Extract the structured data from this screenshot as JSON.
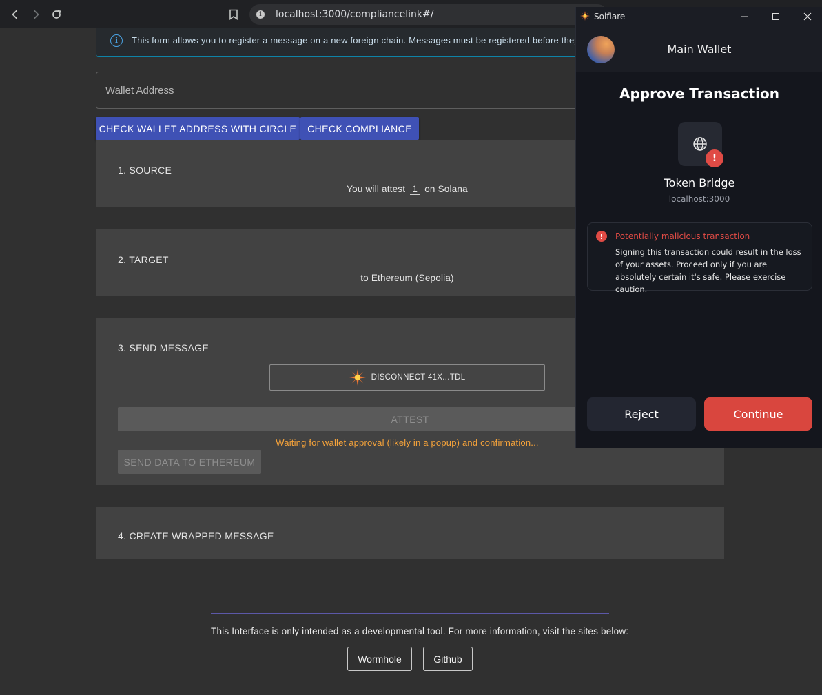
{
  "browser": {
    "url": "localhost:3000/compliancelink#/",
    "icons": {
      "back": "arrow-left-icon",
      "forward": "arrow-right-icon",
      "reload": "reload-icon",
      "bookmark": "bookmark-icon",
      "site_info": "info-icon"
    }
  },
  "page": {
    "info_banner": "This form allows you to register a message on a new foreign chain. Messages must be registered before they can be transferred.",
    "wallet_input_placeholder": "Wallet Address",
    "buttons": {
      "check_circle": "CHECK WALLET ADDRESS WITH CIRCLE",
      "check_compliance": "CHECK COMPLIANCE"
    },
    "sections": {
      "source": {
        "title": "1. SOURCE",
        "text_before": "You will attest",
        "amount": "1",
        "text_after": "on Solana"
      },
      "target": {
        "title": "2. TARGET",
        "text": "to Ethereum (Sepolia)"
      },
      "send": {
        "title": "3. SEND MESSAGE",
        "disconnect_label": "DISCONNECT 41X...TDL",
        "attest_label": "ATTEST",
        "waiting_text": "Waiting for wallet approval (likely in a popup) and confirmation...",
        "send_data_label": "SEND DATA TO ETHEREUM"
      },
      "wrapped": {
        "title": "4. CREATE WRAPPED MESSAGE"
      }
    },
    "footer": {
      "text": "This Interface is only intended as a developmental tool. For more information, visit the sites below:",
      "links": [
        "Wormhole",
        "Github"
      ]
    }
  },
  "popup": {
    "app_title": "Solflare",
    "wallet_name": "Main Wallet",
    "heading": "Approve Transaction",
    "dapp_name": "Token Bridge",
    "dapp_host": "localhost:3000",
    "warning_title": "Potentially malicious transaction",
    "warning_body": "Signing this transaction could result in the loss of your assets. Proceed only if you are absolutely certain it's safe. Please exercise caution.",
    "reject_label": "Reject",
    "continue_label": "Continue",
    "colors": {
      "danger": "#d9463e",
      "accent": "#3f51b5",
      "warning_text": "#f6a33a"
    }
  }
}
